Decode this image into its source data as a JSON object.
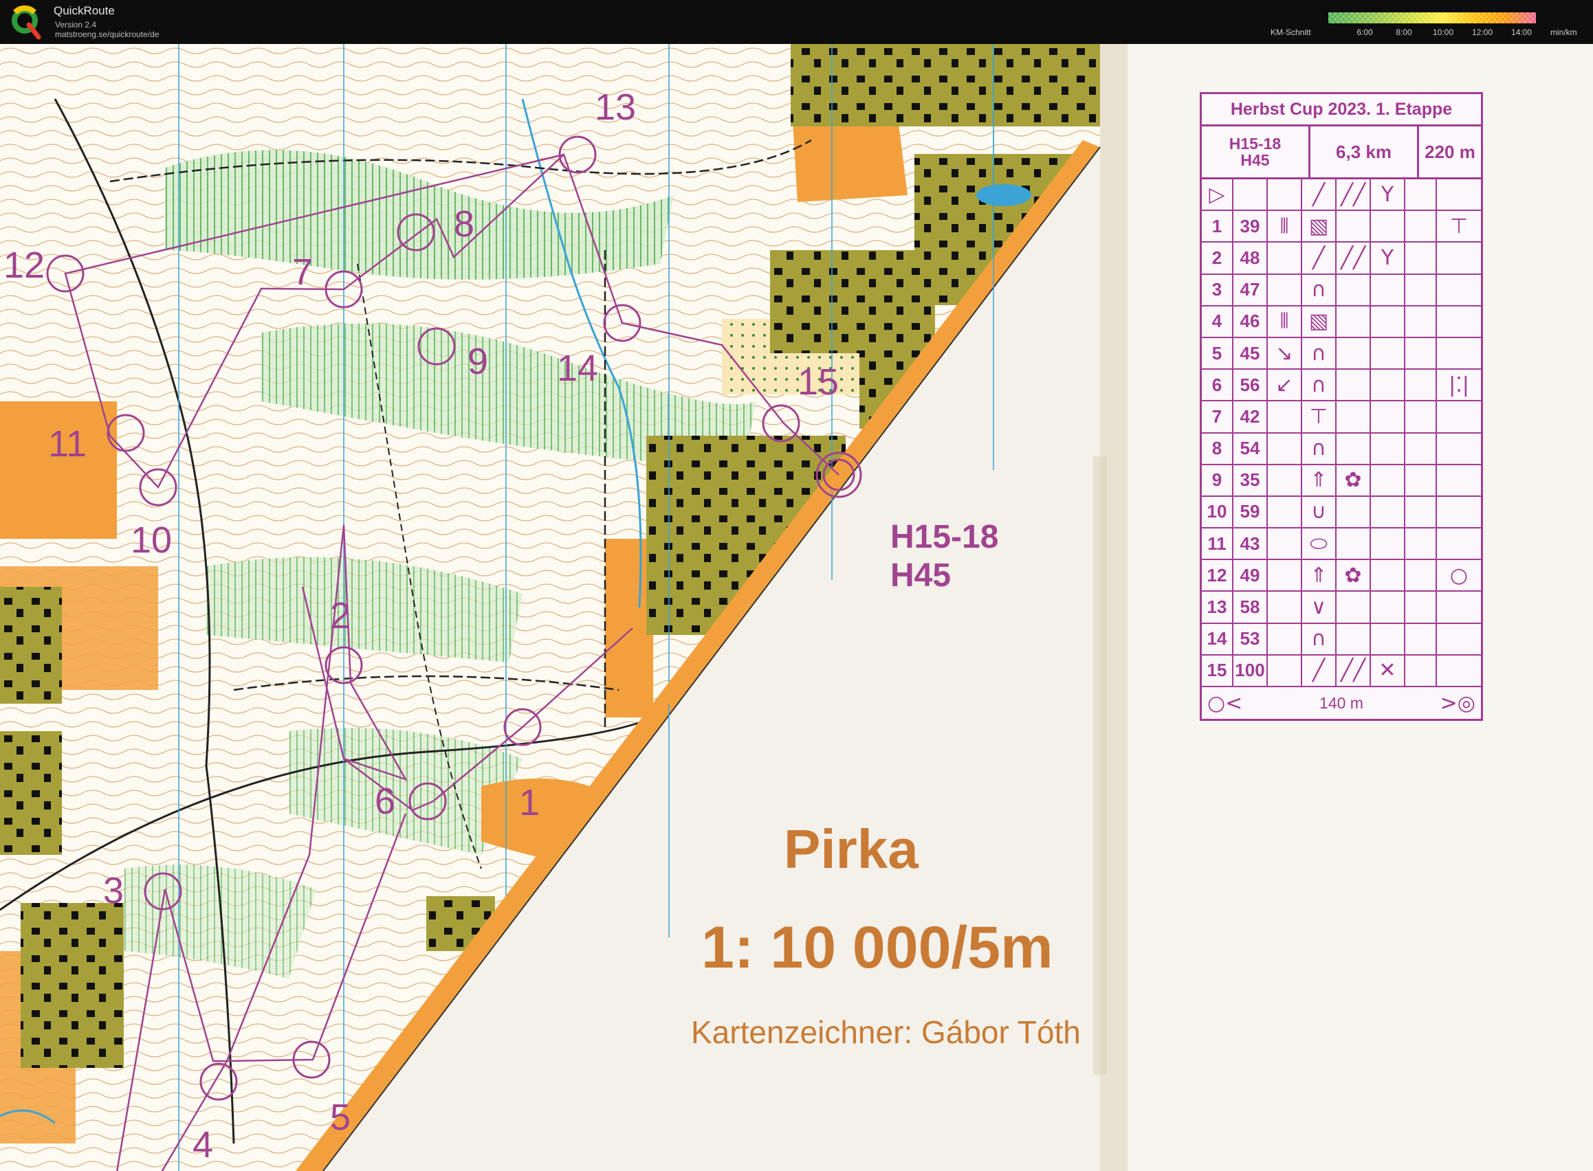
{
  "app": {
    "title": "QuickRoute",
    "version": "Version 2.4",
    "url": "matstroeng.se/quickroute/de",
    "pace_label": "KM-Schnitt",
    "pace_ticks": [
      "6:00",
      "8:00",
      "10:00",
      "12:00",
      "14:00"
    ],
    "pace_unit": "min/km",
    "pace_colors": [
      "#4caf50",
      "#8bc34a",
      "#cddc39",
      "#ffeb3b",
      "#ffc107",
      "#ff9800",
      "#f06292"
    ]
  },
  "map": {
    "event_classes": [
      "H15-18",
      "H45"
    ],
    "area_name": "Pirka",
    "scale": "1: 10 000/5m",
    "cartographer": "Kartenzeichner: Gábor Tóth",
    "control_numbers": [
      "1",
      "2",
      "3",
      "4",
      "5",
      "6",
      "7",
      "8",
      "9",
      "10",
      "11",
      "12",
      "13",
      "14",
      "15"
    ],
    "course_color": "#a0448f",
    "field_color": "#f2a03d"
  },
  "description_sheet": {
    "title": "Herbst Cup 2023. 1. Etappe",
    "classes": [
      "H15-18",
      "H45"
    ],
    "length": "6,3 km",
    "climb": "220 m",
    "start_row": {
      "col_d": "╱",
      "col_e": "╱╱",
      "col_f": "Y"
    },
    "rows": [
      {
        "num": "1",
        "code": "39",
        "c": "⫴",
        "d": "▧",
        "e": "",
        "f": "",
        "g": "⊤"
      },
      {
        "num": "2",
        "code": "48",
        "c": "",
        "d": "╱",
        "e": "╱╱",
        "f": "Y",
        "g": ""
      },
      {
        "num": "3",
        "code": "47",
        "c": "",
        "d": "∩",
        "e": "",
        "f": "",
        "g": ""
      },
      {
        "num": "4",
        "code": "46",
        "c": "⫴",
        "d": "▧",
        "e": "",
        "f": "",
        "g": ""
      },
      {
        "num": "5",
        "code": "45",
        "c": "↘",
        "d": "∩",
        "e": "",
        "f": "",
        "g": ""
      },
      {
        "num": "6",
        "code": "56",
        "c": "↙",
        "d": "∩",
        "e": "",
        "f": "",
        "g": "|⁚|"
      },
      {
        "num": "7",
        "code": "42",
        "c": "",
        "d": "⊤",
        "e": "",
        "f": "",
        "g": ""
      },
      {
        "num": "8",
        "code": "54",
        "c": "",
        "d": "∩",
        "e": "",
        "f": "",
        "g": ""
      },
      {
        "num": "9",
        "code": "35",
        "c": "",
        "d": "⇑",
        "e": "✿",
        "f": "",
        "g": ""
      },
      {
        "num": "10",
        "code": "59",
        "c": "",
        "d": "∪",
        "e": "",
        "f": "",
        "g": ""
      },
      {
        "num": "11",
        "code": "43",
        "c": "",
        "d": "⬭",
        "e": "",
        "f": "",
        "g": ""
      },
      {
        "num": "12",
        "code": "49",
        "c": "",
        "d": "⇑",
        "e": "✿",
        "f": "",
        "g": "○"
      },
      {
        "num": "13",
        "code": "58",
        "c": "",
        "d": "∨",
        "e": "",
        "f": "",
        "g": ""
      },
      {
        "num": "14",
        "code": "53",
        "c": "",
        "d": "∩",
        "e": "",
        "f": "",
        "g": ""
      },
      {
        "num": "15",
        "code": "100",
        "c": "",
        "d": "╱",
        "e": "╱╱",
        "f": "✕",
        "g": ""
      }
    ],
    "finish_distance": "140 m"
  }
}
